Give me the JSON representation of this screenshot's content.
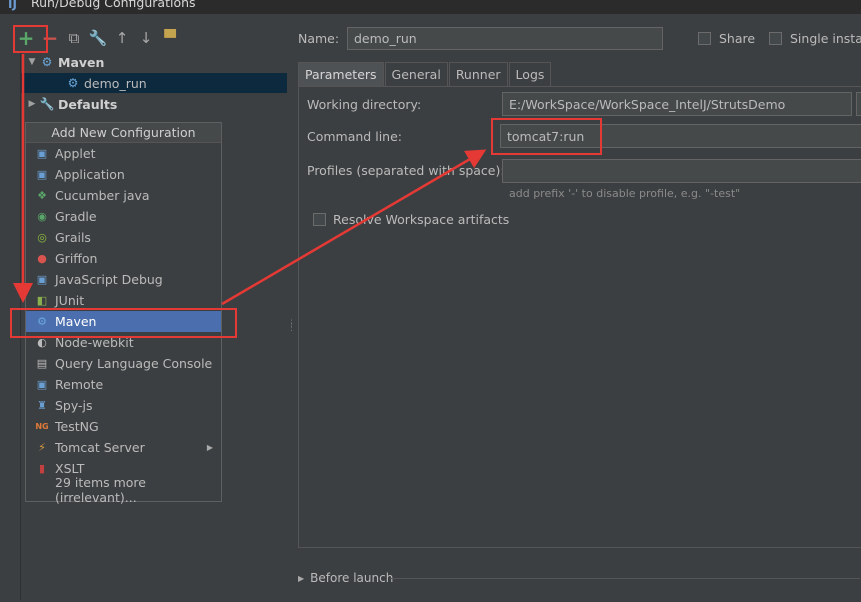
{
  "window": {
    "title": "Run/Debug Configurations"
  },
  "toolbar": {
    "add": "+",
    "remove": "−",
    "copy": "⧉",
    "edit_defaults": "🔧",
    "move_up": "↑",
    "move_down": "↓",
    "folder": "▀"
  },
  "tree": {
    "maven_label": "Maven",
    "demo_run_label": "demo_run",
    "defaults_label": "Defaults"
  },
  "popup": {
    "header": "Add New Configuration",
    "items": [
      {
        "label": "Applet",
        "icon": "applet-icon",
        "color": "#6a9fd4"
      },
      {
        "label": "Application",
        "icon": "application-icon",
        "color": "#6a9fd4"
      },
      {
        "label": "Cucumber java",
        "icon": "cucumber-icon",
        "color": "#59a869"
      },
      {
        "label": "Gradle",
        "icon": "gradle-icon",
        "color": "#59a869"
      },
      {
        "label": "Grails",
        "icon": "grails-icon",
        "color": "#8fbf3f"
      },
      {
        "label": "Griffon",
        "icon": "griffon-icon",
        "color": "#d9534f"
      },
      {
        "label": "JavaScript Debug",
        "icon": "javascript-debug-icon",
        "color": "#6a9fd4"
      },
      {
        "label": "JUnit",
        "icon": "junit-icon",
        "color": "#8ab04e"
      },
      {
        "label": "Maven",
        "icon": "maven-gear-icon",
        "color": "#6aa7da"
      },
      {
        "label": "Node-webkit",
        "icon": "node-webkit-icon",
        "color": "#bbbbbb"
      },
      {
        "label": "Query Language Console",
        "icon": "query-console-icon",
        "color": "#bbbbbb"
      },
      {
        "label": "Remote",
        "icon": "remote-icon",
        "color": "#6a9fd4"
      },
      {
        "label": "Spy-js",
        "icon": "spy-js-icon",
        "color": "#6a9fd4"
      },
      {
        "label": "TestNG",
        "icon": "testng-icon",
        "color": "#e07b39"
      },
      {
        "label": "Tomcat Server",
        "icon": "tomcat-icon",
        "color": "#d99a3f"
      },
      {
        "label": "XSLT",
        "icon": "xslt-icon",
        "color": "#c24040"
      }
    ],
    "more": "29 items more (irrelevant)..."
  },
  "form": {
    "name_label": "Name:",
    "name_value": "demo_run",
    "share_label": "Share",
    "single_label": "Single instan",
    "tabs": [
      "Parameters",
      "General",
      "Runner",
      "Logs"
    ],
    "working_dir_label": "Working directory:",
    "working_dir_value": "E:/WorkSpace/WorkSpace_IntelJ/StrutsDemo",
    "command_line_label": "Command line:",
    "command_line_value": "tomcat7:run",
    "profiles_label": "Profiles (separated with space):",
    "profiles_value": "",
    "profiles_hint": "add prefix '-' to disable profile, e.g. \"-test\"",
    "resolve_label": "Resolve Workspace artifacts",
    "before_launch_label": "Before launch"
  },
  "colors": {
    "background": "#3c3f41",
    "selection": "#4b6eaf",
    "annotation": "#e53935",
    "add_green": "#59a869"
  }
}
